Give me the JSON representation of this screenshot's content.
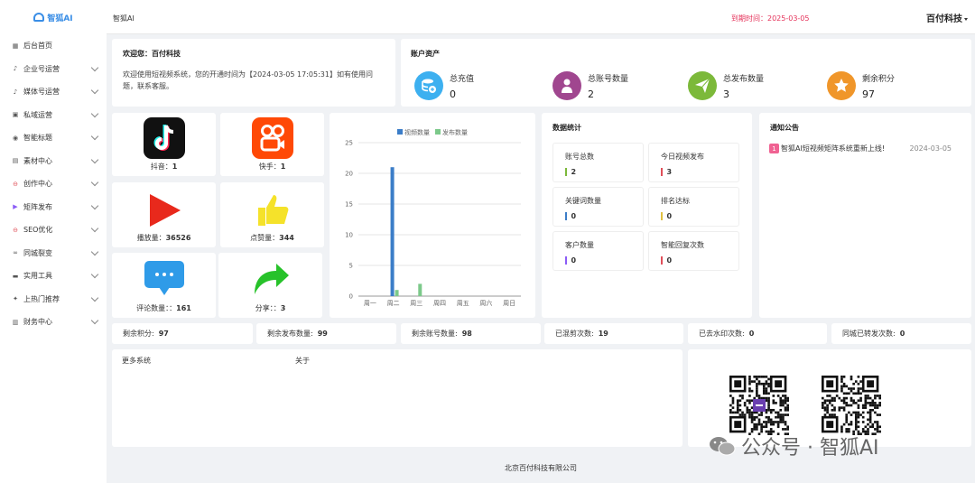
{
  "sidebar": {
    "logo_text": "智狐AI",
    "items": [
      {
        "label": "后台首页",
        "icon": "grid-icon",
        "has_submenu": false
      },
      {
        "label": "企业号运营",
        "icon": "tiktok-icon",
        "has_submenu": true
      },
      {
        "label": "媒体号运营",
        "icon": "tiktok-icon",
        "has_submenu": true
      },
      {
        "label": "私域运营",
        "icon": "image-icon",
        "has_submenu": true
      },
      {
        "label": "智能标题",
        "icon": "robot-icon",
        "has_submenu": true
      },
      {
        "label": "素材中心",
        "icon": "folder-icon",
        "has_submenu": true
      },
      {
        "label": "创作中心",
        "icon": "circle-icon",
        "has_submenu": true
      },
      {
        "label": "矩阵发布",
        "icon": "video-icon",
        "has_submenu": true
      },
      {
        "label": "SEO优化",
        "icon": "circle-icon",
        "has_submenu": true
      },
      {
        "label": "同城裂变",
        "icon": "link-icon",
        "has_submenu": true
      },
      {
        "label": "实用工具",
        "icon": "toolbox-icon",
        "has_submenu": true
      },
      {
        "label": "上热门推荐",
        "icon": "fire-icon",
        "has_submenu": true
      },
      {
        "label": "财务中心",
        "icon": "wallet-icon",
        "has_submenu": true
      }
    ]
  },
  "header": {
    "title": "智狐AI",
    "expire_text": "到期时间：2025-03-05",
    "user": "百付科技"
  },
  "welcome": {
    "title": "欢迎您：百付科技",
    "text": "欢迎使用短视频系统，您的开通时间为【2024-03-05 17:05:31】如有使用问题，联系客服。"
  },
  "assets": {
    "title": "账户资产",
    "items": [
      {
        "label": "总充值",
        "value": "0",
        "color": "#3db0f0",
        "icon": "database-icon"
      },
      {
        "label": "总账号数量",
        "value": "2",
        "color": "#a0468f",
        "icon": "user-icon"
      },
      {
        "label": "总发布数量",
        "value": "3",
        "color": "#7cb93a",
        "icon": "send-icon"
      },
      {
        "label": "剩余积分",
        "value": "97",
        "color": "#f0962a",
        "icon": "star-icon"
      }
    ]
  },
  "platforms": [
    {
      "label": "抖音：",
      "value": "1",
      "icon": "douyin-icon"
    },
    {
      "label": "快手：",
      "value": "1",
      "icon": "kuaishou-icon"
    },
    {
      "label": "播放量：",
      "value": "36526",
      "icon": "play-icon"
    },
    {
      "label": "点赞量：",
      "value": "344",
      "icon": "thumbs-up-icon"
    },
    {
      "label": "评论数量：：",
      "value": "161",
      "icon": "comment-icon"
    },
    {
      "label": "分享：：",
      "value": "3",
      "icon": "share-icon"
    }
  ],
  "chart_data": {
    "type": "bar",
    "categories": [
      "周一",
      "周二",
      "周三",
      "周四",
      "周五",
      "周六",
      "周日"
    ],
    "series": [
      {
        "name": "视频数量",
        "values": [
          0,
          21,
          0,
          0,
          0,
          0,
          0
        ],
        "color": "#3b7dc8"
      },
      {
        "name": "发布数量",
        "values": [
          0,
          1,
          2,
          0,
          0,
          0,
          0
        ],
        "color": "#7cc98a"
      }
    ],
    "yticks": [
      "0",
      "5",
      "10",
      "15",
      "20",
      "25"
    ],
    "ylim": [
      0,
      25
    ],
    "legend": "top-center",
    "grid": true
  },
  "stats": {
    "title": "数据统计",
    "items": [
      {
        "label": "账号总数",
        "value": "2",
        "color": "#7cb93a"
      },
      {
        "label": "今日视频发布",
        "value": "3",
        "color": "#e0505a"
      },
      {
        "label": "关键词数量",
        "value": "0",
        "color": "#3b7dc8"
      },
      {
        "label": "排名达标",
        "value": "0",
        "color": "#e0c040"
      },
      {
        "label": "客户数量",
        "value": "0",
        "color": "#8b5cf6"
      },
      {
        "label": "智能回复次数",
        "value": "0",
        "color": "#e0505a"
      }
    ]
  },
  "notice": {
    "title": "通知公告",
    "items": [
      {
        "num": "1",
        "text": "智狐AI短视频矩阵系统重新上线!",
        "date": "2024-03-05"
      }
    ]
  },
  "mini_stats": [
    {
      "label": "剩余积分:",
      "value": "97"
    },
    {
      "label": "剩余发布数量:",
      "value": "99"
    },
    {
      "label": "剩余账号数量:",
      "value": "98"
    },
    {
      "label": "已混剪次数:",
      "value": "19"
    },
    {
      "label": "已去水印次数:",
      "value": "0"
    },
    {
      "label": "同城已转发次数:",
      "value": "0"
    }
  ],
  "bottom": {
    "more_systems": "更多系统",
    "about": "关于"
  },
  "watermark": "公众号 · 智狐AI",
  "footer": "北京百付科技有限公司"
}
